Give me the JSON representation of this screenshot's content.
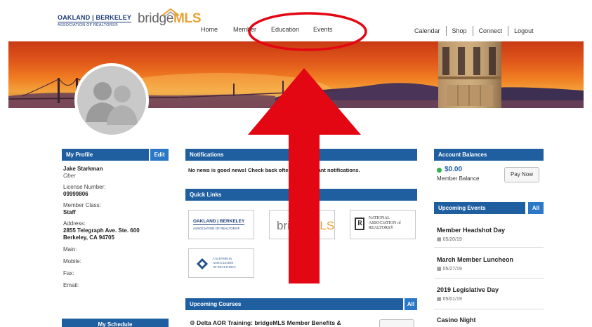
{
  "header": {
    "logo_line1": "OAKLAND | BERKELEY",
    "logo_line2": "ASSOCIATION OF REALTORS®",
    "bridge_prefix": "bridge",
    "bridge_suffix": "MLS",
    "nav_left": [
      "Home",
      "Member",
      "Education",
      "Events"
    ],
    "nav_right": [
      "Calendar",
      "Shop",
      "Connect",
      "Logout"
    ]
  },
  "profile": {
    "heading": "My Profile",
    "edit_label": "Edit",
    "name": "Jake Starkman",
    "role": "Ober",
    "license_label": "License Number:",
    "license_value": "09999806",
    "member_class_label": "Member Class:",
    "member_class_value": "Staff",
    "address_label": "Address:",
    "address_line1": "2855 Telegraph Ave. Ste. 600",
    "address_line2": "Berkeley, CA 94705",
    "main_label": "Main:",
    "mobile_label": "Mobile:",
    "fax_label": "Fax:",
    "email_label": "Email:",
    "schedule_heading": "My Schedule"
  },
  "notifications": {
    "heading": "Notifications",
    "text": "No news is good news! Check back often for important notifications."
  },
  "quick_links": {
    "heading": "Quick Links",
    "oab_line1": "OAKLAND | BERKELEY",
    "oab_line2": "ASSOCIATION OF REALTORS®",
    "bridge_prefix": "bridge",
    "bridge_suffix": "MLS",
    "nar_line1": "NATIONAL",
    "nar_line2": "ASSOCIATION of",
    "nar_line3": "REALTORS®",
    "car_line1": "CALIFORNIA",
    "car_line2": "ASSOCIATION",
    "car_line3": "OF REALTORS®"
  },
  "courses": {
    "heading": "Upcoming Courses",
    "all_label": "All",
    "first_course": "Delta AOR Training: bridgeMLS Member Benefits &"
  },
  "account": {
    "heading": "Account Balances",
    "amount": "$0.00",
    "sub": "Member Balance",
    "pay_label": "Pay Now"
  },
  "events": {
    "heading": "Upcoming Events",
    "all_label": "All",
    "items": [
      {
        "title": "Member Headshot Day",
        "date": "05/20/19"
      },
      {
        "title": "March Member Luncheon",
        "date": "05/27/19"
      },
      {
        "title": "2019 Legislative Day",
        "date": "05/01/19"
      },
      {
        "title": "Casino Night",
        "date": ""
      }
    ]
  },
  "colors": {
    "header_blue": "#1f5fa0",
    "badge_blue": "#2a78c6",
    "annotation_red": "#e30613",
    "mls_orange": "#e8a134"
  }
}
